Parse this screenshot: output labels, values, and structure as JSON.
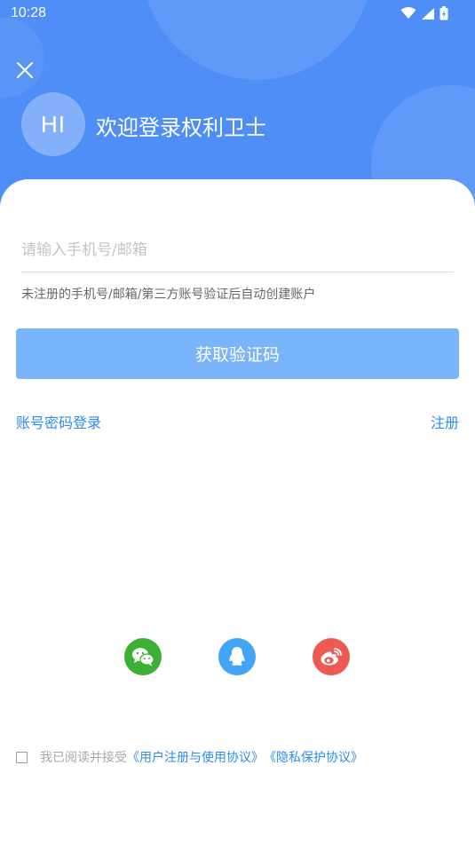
{
  "status_bar": {
    "time": "10:28"
  },
  "header": {
    "avatar_text": "HI",
    "welcome": "欢迎登录权利卫士"
  },
  "login": {
    "phone_placeholder": "请输入手机号/邮箱",
    "hint": "未注册的手机号/邮箱/第三方账号验证后自动创建账户",
    "verify_button": "获取验证码",
    "password_login": "账号密码登录",
    "register": "注册"
  },
  "social": {
    "wechat_color": "#3cb034",
    "qq_color": "#42a5f5",
    "weibo_color": "#ec5a52"
  },
  "agreement": {
    "prefix": "我已阅读并接受",
    "user_agreement": "《用户注册与使用协议》",
    "privacy_policy": "《隐私保护协议》"
  },
  "colors": {
    "header_bg": "#4f8ef7",
    "button_bg": "#7ab4fb",
    "link": "#2d8cf0"
  }
}
